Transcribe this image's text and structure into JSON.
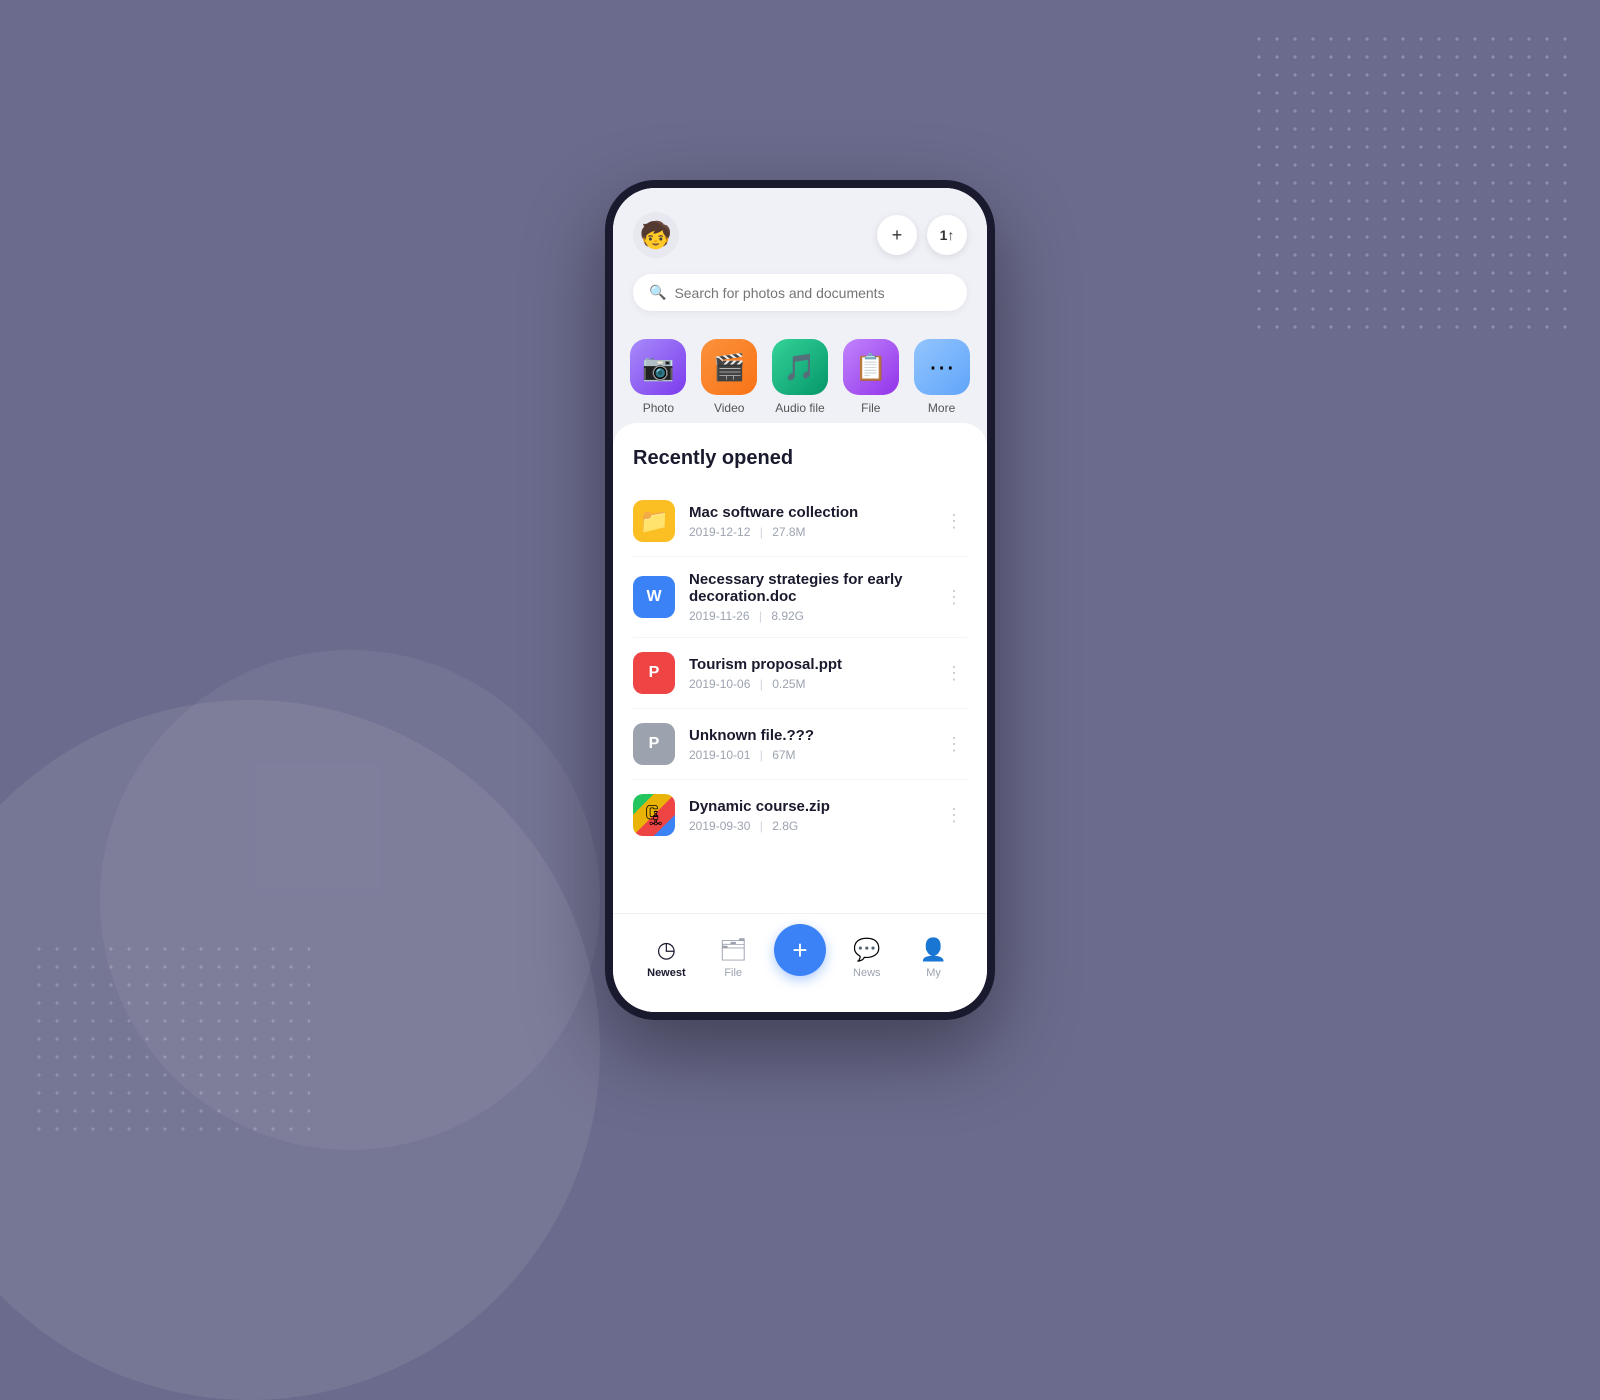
{
  "background": {
    "color": "#6b6b8d"
  },
  "header": {
    "avatar_emoji": "🧒",
    "add_btn_label": "+",
    "sort_btn_label": "↕"
  },
  "search": {
    "placeholder": "Search for photos and documents"
  },
  "categories": [
    {
      "id": "photo",
      "label": "Photo",
      "emoji": "📷",
      "class": "cat-photo"
    },
    {
      "id": "video",
      "label": "Video",
      "emoji": "🎥",
      "class": "cat-video"
    },
    {
      "id": "audio",
      "label": "Audio file",
      "emoji": "🎵",
      "class": "cat-audio"
    },
    {
      "id": "file",
      "label": "File",
      "emoji": "📁",
      "class": "cat-file"
    },
    {
      "id": "more",
      "label": "More",
      "emoji": "⋯",
      "class": "cat-more"
    }
  ],
  "recently_opened": {
    "title": "Recently opened",
    "files": [
      {
        "id": "mac-software",
        "name": "Mac software collection",
        "date": "2019-12-12",
        "size": "27.8M",
        "icon_type": "folder",
        "icon_class": "icon-folder",
        "icon_emoji": "📁"
      },
      {
        "id": "strategies-doc",
        "name": "Necessary strategies for early decoration.doc",
        "date": "2019-11-26",
        "size": "8.92G",
        "icon_type": "word",
        "icon_class": "icon-word",
        "icon_emoji": "W"
      },
      {
        "id": "tourism-ppt",
        "name": "Tourism proposal.ppt",
        "date": "2019-10-06",
        "size": "0.25M",
        "icon_type": "ppt",
        "icon_class": "icon-ppt",
        "icon_emoji": "P"
      },
      {
        "id": "unknown-file",
        "name": "Unknown file.???",
        "date": "2019-10-01",
        "size": "67M",
        "icon_type": "unknown",
        "icon_class": "icon-unknown",
        "icon_emoji": "P"
      },
      {
        "id": "dynamic-zip",
        "name": "Dynamic course.zip",
        "date": "2019-09-30",
        "size": "2.8G",
        "icon_type": "zip",
        "icon_class": "icon-zip",
        "icon_emoji": "🗜"
      }
    ]
  },
  "bottom_nav": {
    "items": [
      {
        "id": "newest",
        "label": "Newest",
        "icon": "◷",
        "active": true
      },
      {
        "id": "file",
        "label": "File",
        "icon": "🗂",
        "active": false
      },
      {
        "id": "add",
        "label": "",
        "icon": "+",
        "is_add": true
      },
      {
        "id": "news",
        "label": "News",
        "icon": "💬",
        "active": false
      },
      {
        "id": "my",
        "label": "My",
        "icon": "👤",
        "active": false
      }
    ]
  }
}
